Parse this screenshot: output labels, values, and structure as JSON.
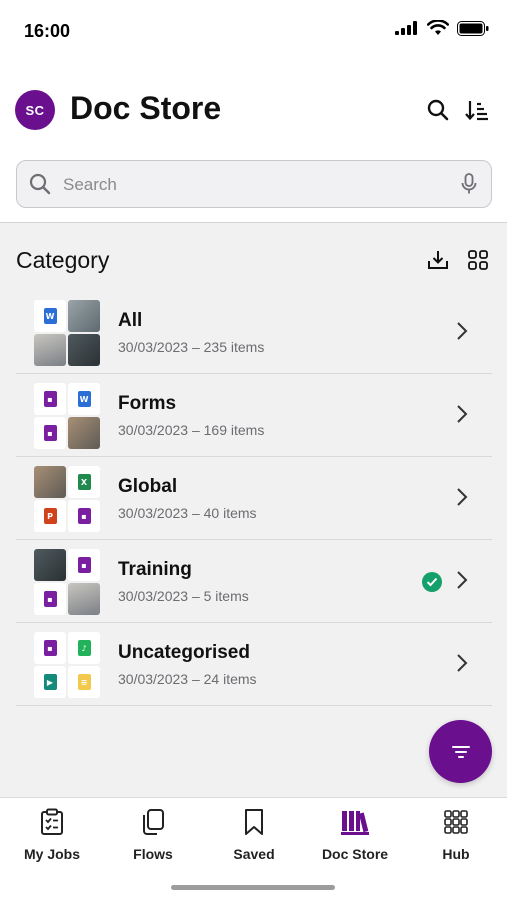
{
  "status": {
    "time": "16:00"
  },
  "header": {
    "avatar_initials": "SC",
    "title": "Doc Store"
  },
  "search": {
    "placeholder": "Search",
    "value": ""
  },
  "section": {
    "title": "Category"
  },
  "categories": [
    {
      "name": "All",
      "meta": "30/03/2023 – 235 items",
      "synced": false
    },
    {
      "name": "Forms",
      "meta": "30/03/2023 – 169 items",
      "synced": false
    },
    {
      "name": "Global",
      "meta": "30/03/2023 – 40 items",
      "synced": false
    },
    {
      "name": "Training",
      "meta": "30/03/2023 – 5 items",
      "synced": true
    },
    {
      "name": "Uncategorised",
      "meta": "30/03/2023 – 24 items",
      "synced": false
    }
  ],
  "tabs": [
    {
      "label": "My Jobs",
      "icon": "clipboard-list-icon",
      "active": false
    },
    {
      "label": "Flows",
      "icon": "copy-icon",
      "active": false
    },
    {
      "label": "Saved",
      "icon": "bookmark-icon",
      "active": false
    },
    {
      "label": "Doc Store",
      "icon": "library-icon",
      "active": true
    },
    {
      "label": "Hub",
      "icon": "grid-dots-icon",
      "active": false
    }
  ],
  "colors": {
    "brand": "#6a0f8e",
    "success": "#13a06a",
    "word": "#2b6fd6",
    "excel": "#1f8a4c",
    "pdf": "#7a1fa0",
    "ppt": "#d0421b"
  }
}
